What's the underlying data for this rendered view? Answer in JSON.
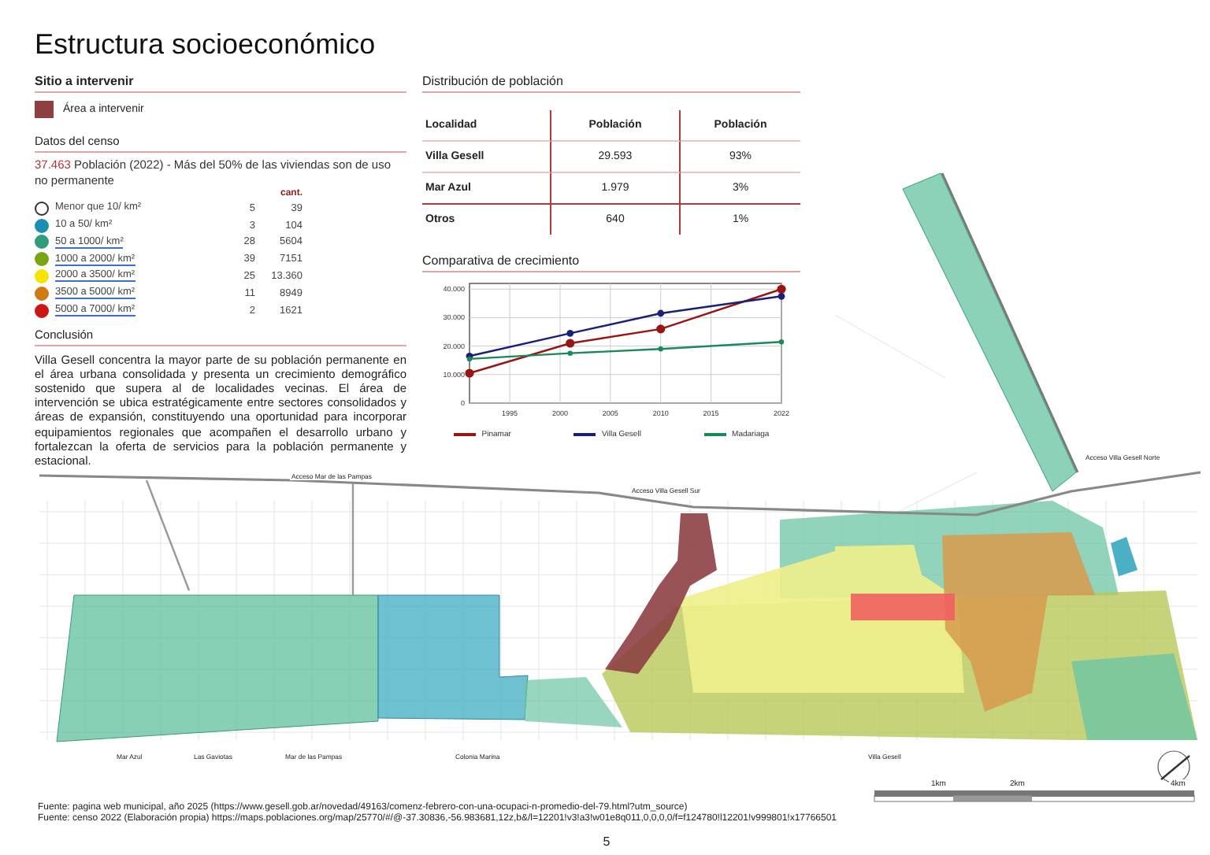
{
  "title": "Estructura socioeconómico",
  "site": {
    "heading": "Sitio a intervenir",
    "legend": {
      "label": "Área a intervenir",
      "color": "#8e3f42"
    }
  },
  "census": {
    "heading": "Datos del censo",
    "highlight": "37.463",
    "summary": "Población (2022) - Más del 50% de las viviendas son de uso no permanente",
    "column_header": "cant.",
    "rows": [
      {
        "label": "Menor que 10/ km²",
        "count": "5",
        "cant": "39",
        "color": "#ffffff",
        "underlined": false
      },
      {
        "label": "10 a 50/ km²",
        "count": "3",
        "cant": "104",
        "color": "#1b8fb3",
        "underlined": false
      },
      {
        "label": "50 a 1000/ km²",
        "count": "28",
        "cant": "5604",
        "color": "#2f9d7c",
        "underlined": true
      },
      {
        "label": "1000 a 2000/ km²",
        "count": "39",
        "cant": "7151",
        "color": "#79a514",
        "underlined": true
      },
      {
        "label": "2000 a 3500/ km²",
        "count": "25",
        "cant": "13.360",
        "color": "#f5e400",
        "underlined": true
      },
      {
        "label": "3500 a 5000/ km²",
        "count": "11",
        "cant": "8949",
        "color": "#cf7a12",
        "underlined": true
      },
      {
        "label": "5000 a 7000/ km²",
        "count": "2",
        "cant": "1621",
        "color": "#cc1616",
        "underlined": true
      }
    ]
  },
  "conclusion": {
    "heading": "Conclusión",
    "text": "Villa Gesell concentra la mayor parte de su población permanente en el área urbana consolidada y presenta un crecimiento demográfico sostenido que supera al de localidades vecinas. El área de intervención se ubica estratégicamente entre sectores consolidados y áreas de expansión, constituyendo una oportunidad para incorporar equipamientos regionales que acompañen el desarrollo urbano y fortalezcan la oferta de servicios para la población permanente y estacional."
  },
  "distribution": {
    "heading": "Distribución de población",
    "columns": [
      "Localidad",
      "Población",
      "Población"
    ],
    "rows": [
      [
        "Villa Gesell",
        "29.593",
        "93%"
      ],
      [
        "Mar Azul",
        "1.979",
        "3%"
      ],
      [
        "Otros",
        "640",
        "1%"
      ]
    ]
  },
  "growth": {
    "heading": "Comparativa de crecimiento",
    "chart_data": {
      "type": "line",
      "grid": true,
      "x": [
        1991,
        2001,
        2010,
        2022
      ],
      "xlim": [
        1991,
        2022
      ],
      "ylim": [
        0,
        42000
      ],
      "xticks": [
        1995,
        2000,
        2005,
        2010,
        2015,
        2022
      ],
      "yticks": [
        {
          "value": 0,
          "label": "0"
        },
        {
          "value": 10000,
          "label": "10.000"
        },
        {
          "value": 20000,
          "label": "20.000"
        },
        {
          "value": 30000,
          "label": "30.000"
        },
        {
          "value": 40000,
          "label": "40.000"
        }
      ],
      "series": [
        {
          "name": "Pinamar",
          "color": "#9b1414",
          "marker": "circle",
          "values": [
            10500,
            21000,
            26000,
            40000
          ]
        },
        {
          "name": "Villa Gesell",
          "color": "#1c1f7a",
          "marker": "circle",
          "values": [
            16500,
            24500,
            31500,
            37500
          ]
        },
        {
          "name": "Madariaga",
          "color": "#17895a",
          "marker": "circle",
          "values": [
            15500,
            17500,
            19000,
            21500
          ]
        }
      ]
    }
  },
  "map": {
    "access_labels": [
      "Acceso Mar de las Pampas",
      "Acceso Villa Gesell Sur",
      "Acceso Villa Gesell Norte"
    ],
    "place_labels": [
      "Mar Azul",
      "Las Gaviotas",
      "Mar de las Pampas",
      "Colonia Marina",
      "Villa Gesell"
    ],
    "scale_labels": [
      "1km",
      "2km",
      "4km"
    ]
  },
  "sources": [
    "Fuente: pagina web municipal, año 2025 (https://www.gesell.gob.ar/novedad/49163/comenz-febrero-con-una-ocupaci-n-promedio-del-79.html?utm_source)",
    "Fuente: censo 2022 (Elaboración propia) https://maps.poblaciones.org/map/25770/#/@-37.30836,-56.983681,12z,b&/l=12201!v3!a3!w01e8q011,0,0,0,0/f=f124780!l12201!v999801!x17766501"
  ],
  "page_number": "5"
}
